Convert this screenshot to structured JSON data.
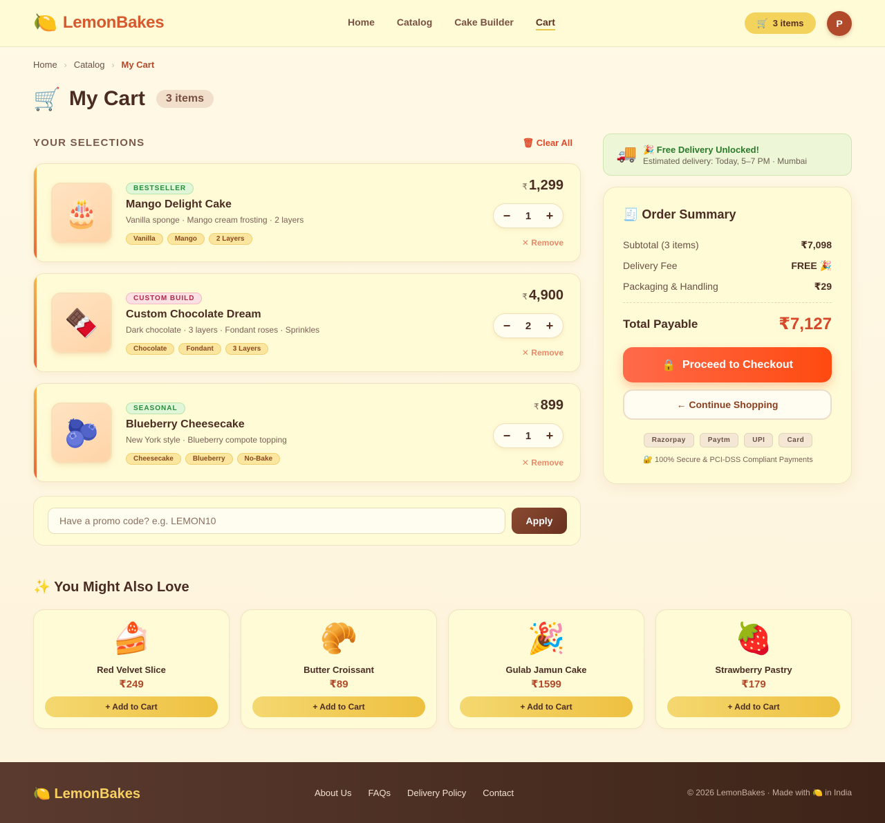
{
  "header": {
    "logo_icon": "🍋",
    "brand": "LemonBakes",
    "nav": [
      "Home",
      "Catalog",
      "Cake Builder",
      "Cart"
    ],
    "active_nav": "Cart",
    "cart_icon": "🛒",
    "cart_label": "3 items",
    "avatar_initial": "P"
  },
  "breadcrumb": [
    "Home",
    "Catalog",
    "My Cart"
  ],
  "page": {
    "title_icon": "🛒",
    "title": "My Cart",
    "count_badge": "3 items"
  },
  "selections": {
    "heading": "YOUR SELECTIONS",
    "clear_all": "🗑 Clear All"
  },
  "cart_items": [
    {
      "emoji": "🎂",
      "badge": "BESTSELLER",
      "badge_color": "green",
      "name": "Mango Delight Cake",
      "description": "Vanilla sponge · Mango cream frosting · 2 layers",
      "tags": [
        "Vanilla",
        "Mango",
        "2 Layers"
      ],
      "currency": "₹",
      "price": "1,299",
      "qty": "1",
      "remove": "✕ Remove"
    },
    {
      "emoji": "🍫",
      "badge": "CUSTOM BUILD",
      "badge_color": "pink",
      "name": "Custom Chocolate Dream",
      "description": "Dark chocolate · 3 layers · Fondant roses · Sprinkles",
      "tags": [
        "Chocolate",
        "Fondant",
        "3 Layers"
      ],
      "currency": "₹",
      "price": "4,900",
      "qty": "2",
      "remove": "✕ Remove"
    },
    {
      "emoji": "🫐",
      "badge": "SEASONAL",
      "badge_color": "green",
      "name": "Blueberry Cheesecake",
      "description": "New York style · Blueberry compote topping",
      "tags": [
        "Cheesecake",
        "Blueberry",
        "No-Bake"
      ],
      "currency": "₹",
      "price": "899",
      "qty": "1",
      "remove": "✕ Remove"
    }
  ],
  "stepper": {
    "minus": "−",
    "plus": "+"
  },
  "promo": {
    "placeholder": "Have a promo code? e.g. LEMON10",
    "value": "",
    "apply_label": "Apply"
  },
  "delivery": {
    "icon": "🚚",
    "title": "🎉 Free Delivery Unlocked!",
    "subtitle": "Estimated delivery: Today, 5–7 PM · Mumbai"
  },
  "summary": {
    "title": "🧾 Order Summary",
    "rows": [
      {
        "label": "Subtotal (3 items)",
        "value": "₹7,098"
      },
      {
        "label": "Delivery Fee",
        "value": "FREE 🎉"
      },
      {
        "label": "Packaging & Handling",
        "value": "₹29"
      }
    ],
    "total_label": "Total Payable",
    "total_value": "₹7,127",
    "checkout_icon": "🔒",
    "checkout_label": "Proceed to Checkout",
    "continue_label": "← Continue Shopping",
    "payment_methods": [
      "Razorpay",
      "Paytm",
      "UPI",
      "Card"
    ],
    "secure_note": "🔐 100% Secure & PCI-DSS Compliant Payments"
  },
  "recommendations": {
    "title": "✨ You Might Also Love",
    "items": [
      {
        "emoji": "🍰",
        "name": "Red Velvet Slice",
        "price": "₹249",
        "add": "+ Add to Cart"
      },
      {
        "emoji": "🥐",
        "name": "Butter Croissant",
        "price": "₹89",
        "add": "+ Add to Cart"
      },
      {
        "emoji": "🎉",
        "name": "Gulab Jamun Cake",
        "price": "₹1599",
        "add": "+ Add to Cart"
      },
      {
        "emoji": "🍓",
        "name": "Strawberry Pastry",
        "price": "₹179",
        "add": "+ Add to Cart"
      }
    ]
  },
  "footer": {
    "logo": "🍋 LemonBakes",
    "links": [
      "About Us",
      "FAQs",
      "Delivery Policy",
      "Contact"
    ],
    "copyright": "© 2026 LemonBakes · Made with 🍋 in India"
  },
  "colors": {
    "brand": "#d65a2e",
    "accent": "#f3d35c",
    "checkout": "#ff4a10",
    "total": "#d6482a"
  }
}
